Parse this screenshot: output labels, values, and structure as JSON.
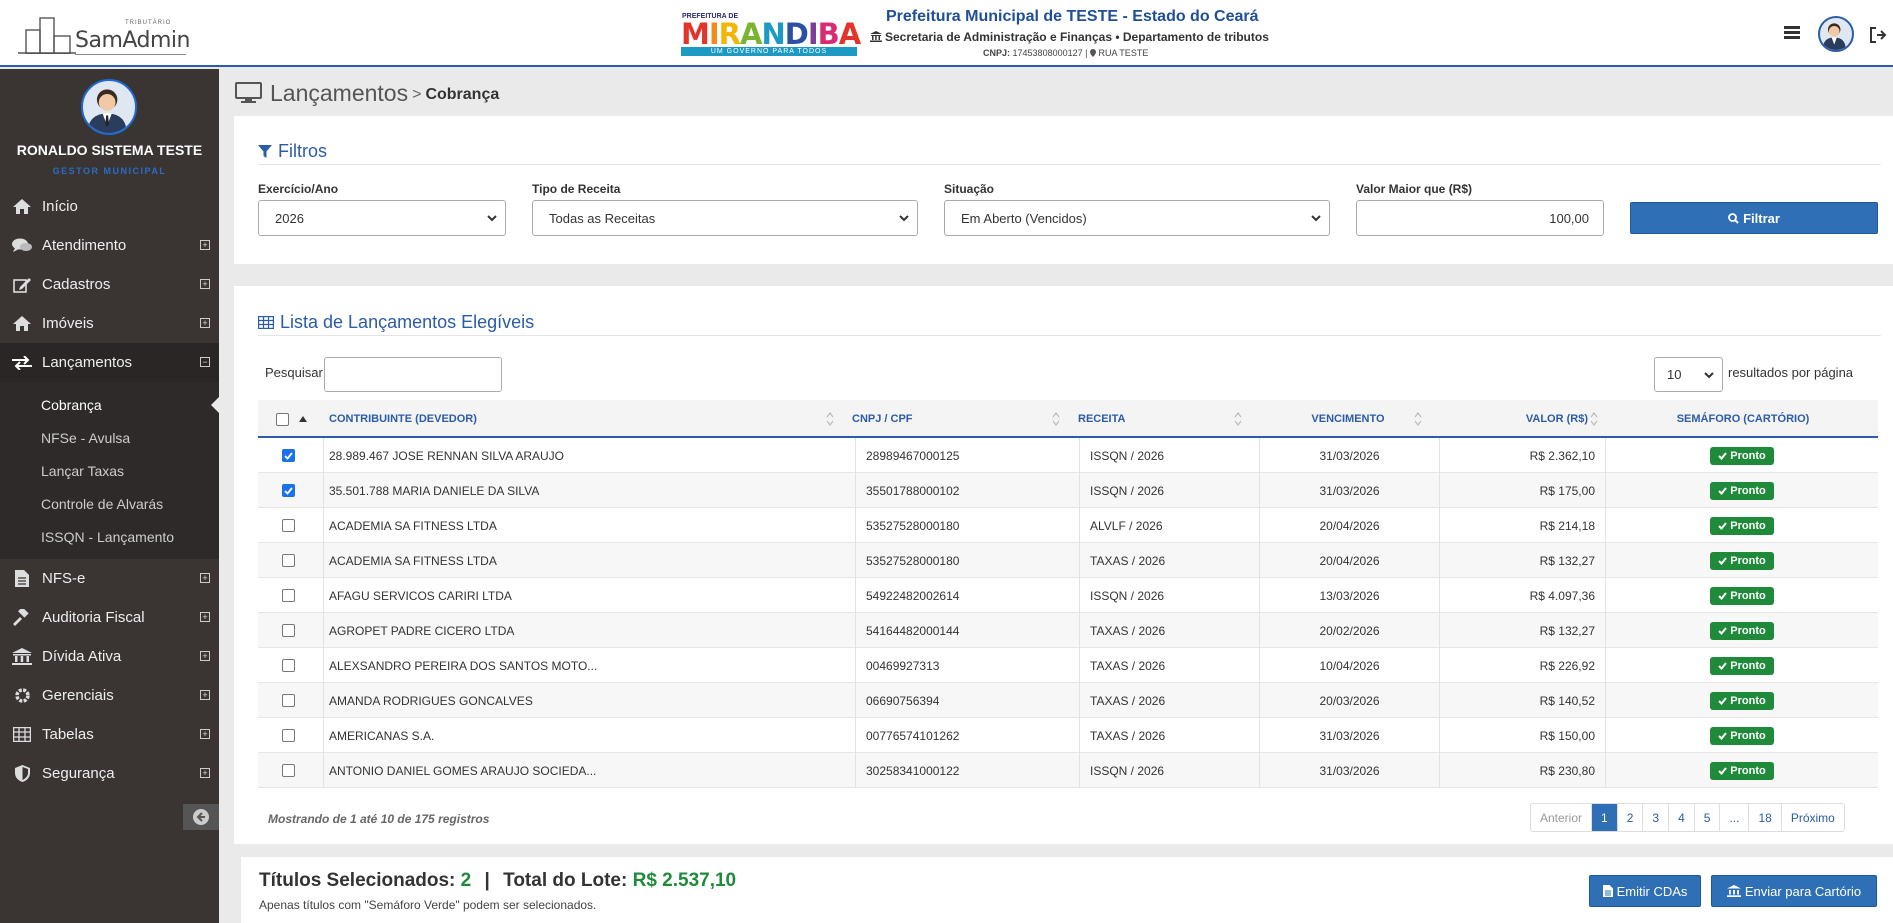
{
  "header": {
    "brand_tag": "TRIBUTÁRIO",
    "brand_name": "SamAdmin",
    "muni_logo_pre": "PREFEITURA DE",
    "muni_logo_name": "MIRANDIBA",
    "muni_logo_slogan": "UM GOVERNO PARA TODOS",
    "title": "Prefeitura Municipal de TESTE - Estado do Ceará",
    "department": "Secretaria de Administração e Finanças • Departamento de tributos",
    "cnpj_label": "CNPJ:",
    "cnpj": "17453808000127",
    "address": "RUA TESTE"
  },
  "sidebar": {
    "user_name": "RONALDO SISTEMA TESTE",
    "user_role": "GESTOR MUNICIPAL",
    "items": [
      {
        "label": "Início",
        "icon": "home-icon"
      },
      {
        "label": "Atendimento",
        "icon": "chat-icon"
      },
      {
        "label": "Cadastros",
        "icon": "edit-icon"
      },
      {
        "label": "Imóveis",
        "icon": "home-icon"
      },
      {
        "label": "Lançamentos",
        "icon": "exchange-icon"
      },
      {
        "label": "NFS-e",
        "icon": "file-icon"
      },
      {
        "label": "Auditoria Fiscal",
        "icon": "gavel-icon"
      },
      {
        "label": "Dívida Ativa",
        "icon": "bank-icon"
      },
      {
        "label": "Gerenciais",
        "icon": "gear-icon"
      },
      {
        "label": "Tabelas",
        "icon": "table-icon"
      },
      {
        "label": "Segurança",
        "icon": "shield-icon"
      }
    ],
    "subitems": [
      "Cobrança",
      "NFSe - Avulsa",
      "Lançar Taxas",
      "Controle de Alvarás",
      "ISSQN - Lançamento"
    ]
  },
  "breadcrumb": {
    "section": "Lançamentos",
    "separator": ">",
    "current": "Cobrança"
  },
  "filters": {
    "title": "Filtros",
    "exercicio_label": "Exercício/Ano",
    "exercicio_value": "2026",
    "tipo_label": "Tipo de Receita",
    "tipo_value": "Todas as Receitas",
    "situacao_label": "Situação",
    "situacao_value": "Em Aberto (Vencidos)",
    "valor_label": "Valor Maior que (R$)",
    "valor_value": "100,00",
    "button": "Filtrar"
  },
  "list": {
    "title": "Lista de Lançamentos Elegíveis",
    "search_label": "Pesquisar",
    "page_size": "10",
    "page_size_suffix": "resultados por página",
    "columns": [
      "CONTRIBUINTE (DEVEDOR)",
      "CNPJ / CPF",
      "RECEITA",
      "VENCIMENTO",
      "VALOR (R$)",
      "SEMÁFORO (CARTÓRIO)"
    ],
    "rows": [
      {
        "checked": true,
        "contribuinte": "28.989.467 JOSE RENNAN SILVA ARAUJO",
        "doc": "28989467000125",
        "receita": "ISSQN / 2026",
        "vencimento": "31/03/2026",
        "valor": "R$ 2.362,10",
        "status": "Pronto"
      },
      {
        "checked": true,
        "contribuinte": "35.501.788 MARIA DANIELE DA SILVA",
        "doc": "35501788000102",
        "receita": "ISSQN / 2026",
        "vencimento": "31/03/2026",
        "valor": "R$ 175,00",
        "status": "Pronto"
      },
      {
        "checked": false,
        "contribuinte": "ACADEMIA SA FITNESS LTDA",
        "doc": "53527528000180",
        "receita": "ALVLF / 2026",
        "vencimento": "20/04/2026",
        "valor": "R$ 214,18",
        "status": "Pronto"
      },
      {
        "checked": false,
        "contribuinte": "ACADEMIA SA FITNESS LTDA",
        "doc": "53527528000180",
        "receita": "TAXAS / 2026",
        "vencimento": "20/04/2026",
        "valor": "R$ 132,27",
        "status": "Pronto"
      },
      {
        "checked": false,
        "contribuinte": "AFAGU SERVICOS CARIRI LTDA",
        "doc": "54922482002614",
        "receita": "ISSQN / 2026",
        "vencimento": "13/03/2026",
        "valor": "R$ 4.097,36",
        "status": "Pronto"
      },
      {
        "checked": false,
        "contribuinte": "AGROPET PADRE CICERO LTDA",
        "doc": "54164482000144",
        "receita": "TAXAS / 2026",
        "vencimento": "20/02/2026",
        "valor": "R$ 132,27",
        "status": "Pronto"
      },
      {
        "checked": false,
        "contribuinte": "ALEXSANDRO PEREIRA DOS SANTOS MOTO...",
        "doc": "00469927313",
        "receita": "TAXAS / 2026",
        "vencimento": "10/04/2026",
        "valor": "R$ 226,92",
        "status": "Pronto"
      },
      {
        "checked": false,
        "contribuinte": "AMANDA RODRIGUES GONCALVES",
        "doc": "06690756394",
        "receita": "TAXAS / 2026",
        "vencimento": "20/03/2026",
        "valor": "R$ 140,52",
        "status": "Pronto"
      },
      {
        "checked": false,
        "contribuinte": "AMERICANAS S.A.",
        "doc": "00776574101262",
        "receita": "TAXAS / 2026",
        "vencimento": "31/03/2026",
        "valor": "R$ 150,00",
        "status": "Pronto"
      },
      {
        "checked": false,
        "contribuinte": "ANTONIO DANIEL GOMES ARAUJO SOCIEDA...",
        "doc": "30258341000122",
        "receita": "ISSQN / 2026",
        "vencimento": "31/03/2026",
        "valor": "R$ 230,80",
        "status": "Pronto"
      }
    ],
    "info": "Mostrando de 1 até 10 de 175 registros",
    "pagination": [
      "Anterior",
      "1",
      "2",
      "3",
      "4",
      "5",
      "...",
      "18",
      "Próximo"
    ]
  },
  "footer": {
    "selected_label": "Títulos Selecionados:",
    "selected_count": "2",
    "separator": "|",
    "total_label": "Total do Lote:",
    "total_value": "R$ 2.537,10",
    "note": "Apenas títulos com \"Semáforo Verde\" podem ser selecionados.",
    "btn_cda": "Emitir CDAs",
    "btn_cartorio": "Enviar para Cartório"
  },
  "colors": {
    "primary": "#2f6fb5",
    "accent": "#2a5ca8",
    "success": "#1f8a3a",
    "sidebar": "#3a3533"
  }
}
